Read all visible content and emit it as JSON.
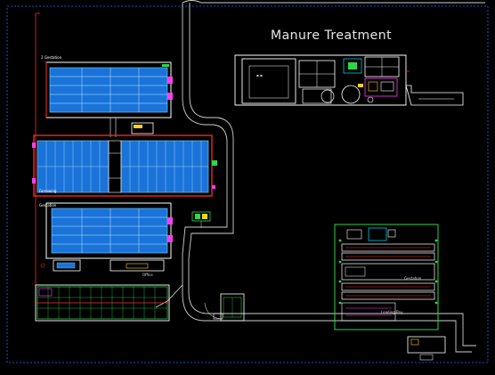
{
  "drawing": {
    "title": "Manure Treatment",
    "labels": {
      "barn_top": "2 Gestation",
      "barn_mid": "Farrowing",
      "barn_lower": "Gestation",
      "office": "Office",
      "building_right": "Gestation",
      "right_lower": "Loading Bay"
    }
  },
  "colors": {
    "background": "#000000",
    "outline": "#ffffff",
    "barn_fill": "#1a73d9",
    "barn_line": "#7fd3ff",
    "red": "#ff2a2a",
    "green": "#2dd64a",
    "magenta": "#ff3df0",
    "yellow": "#ffd21f",
    "cyan": "#00e5ff",
    "grey_road": "#bdbdbd"
  }
}
